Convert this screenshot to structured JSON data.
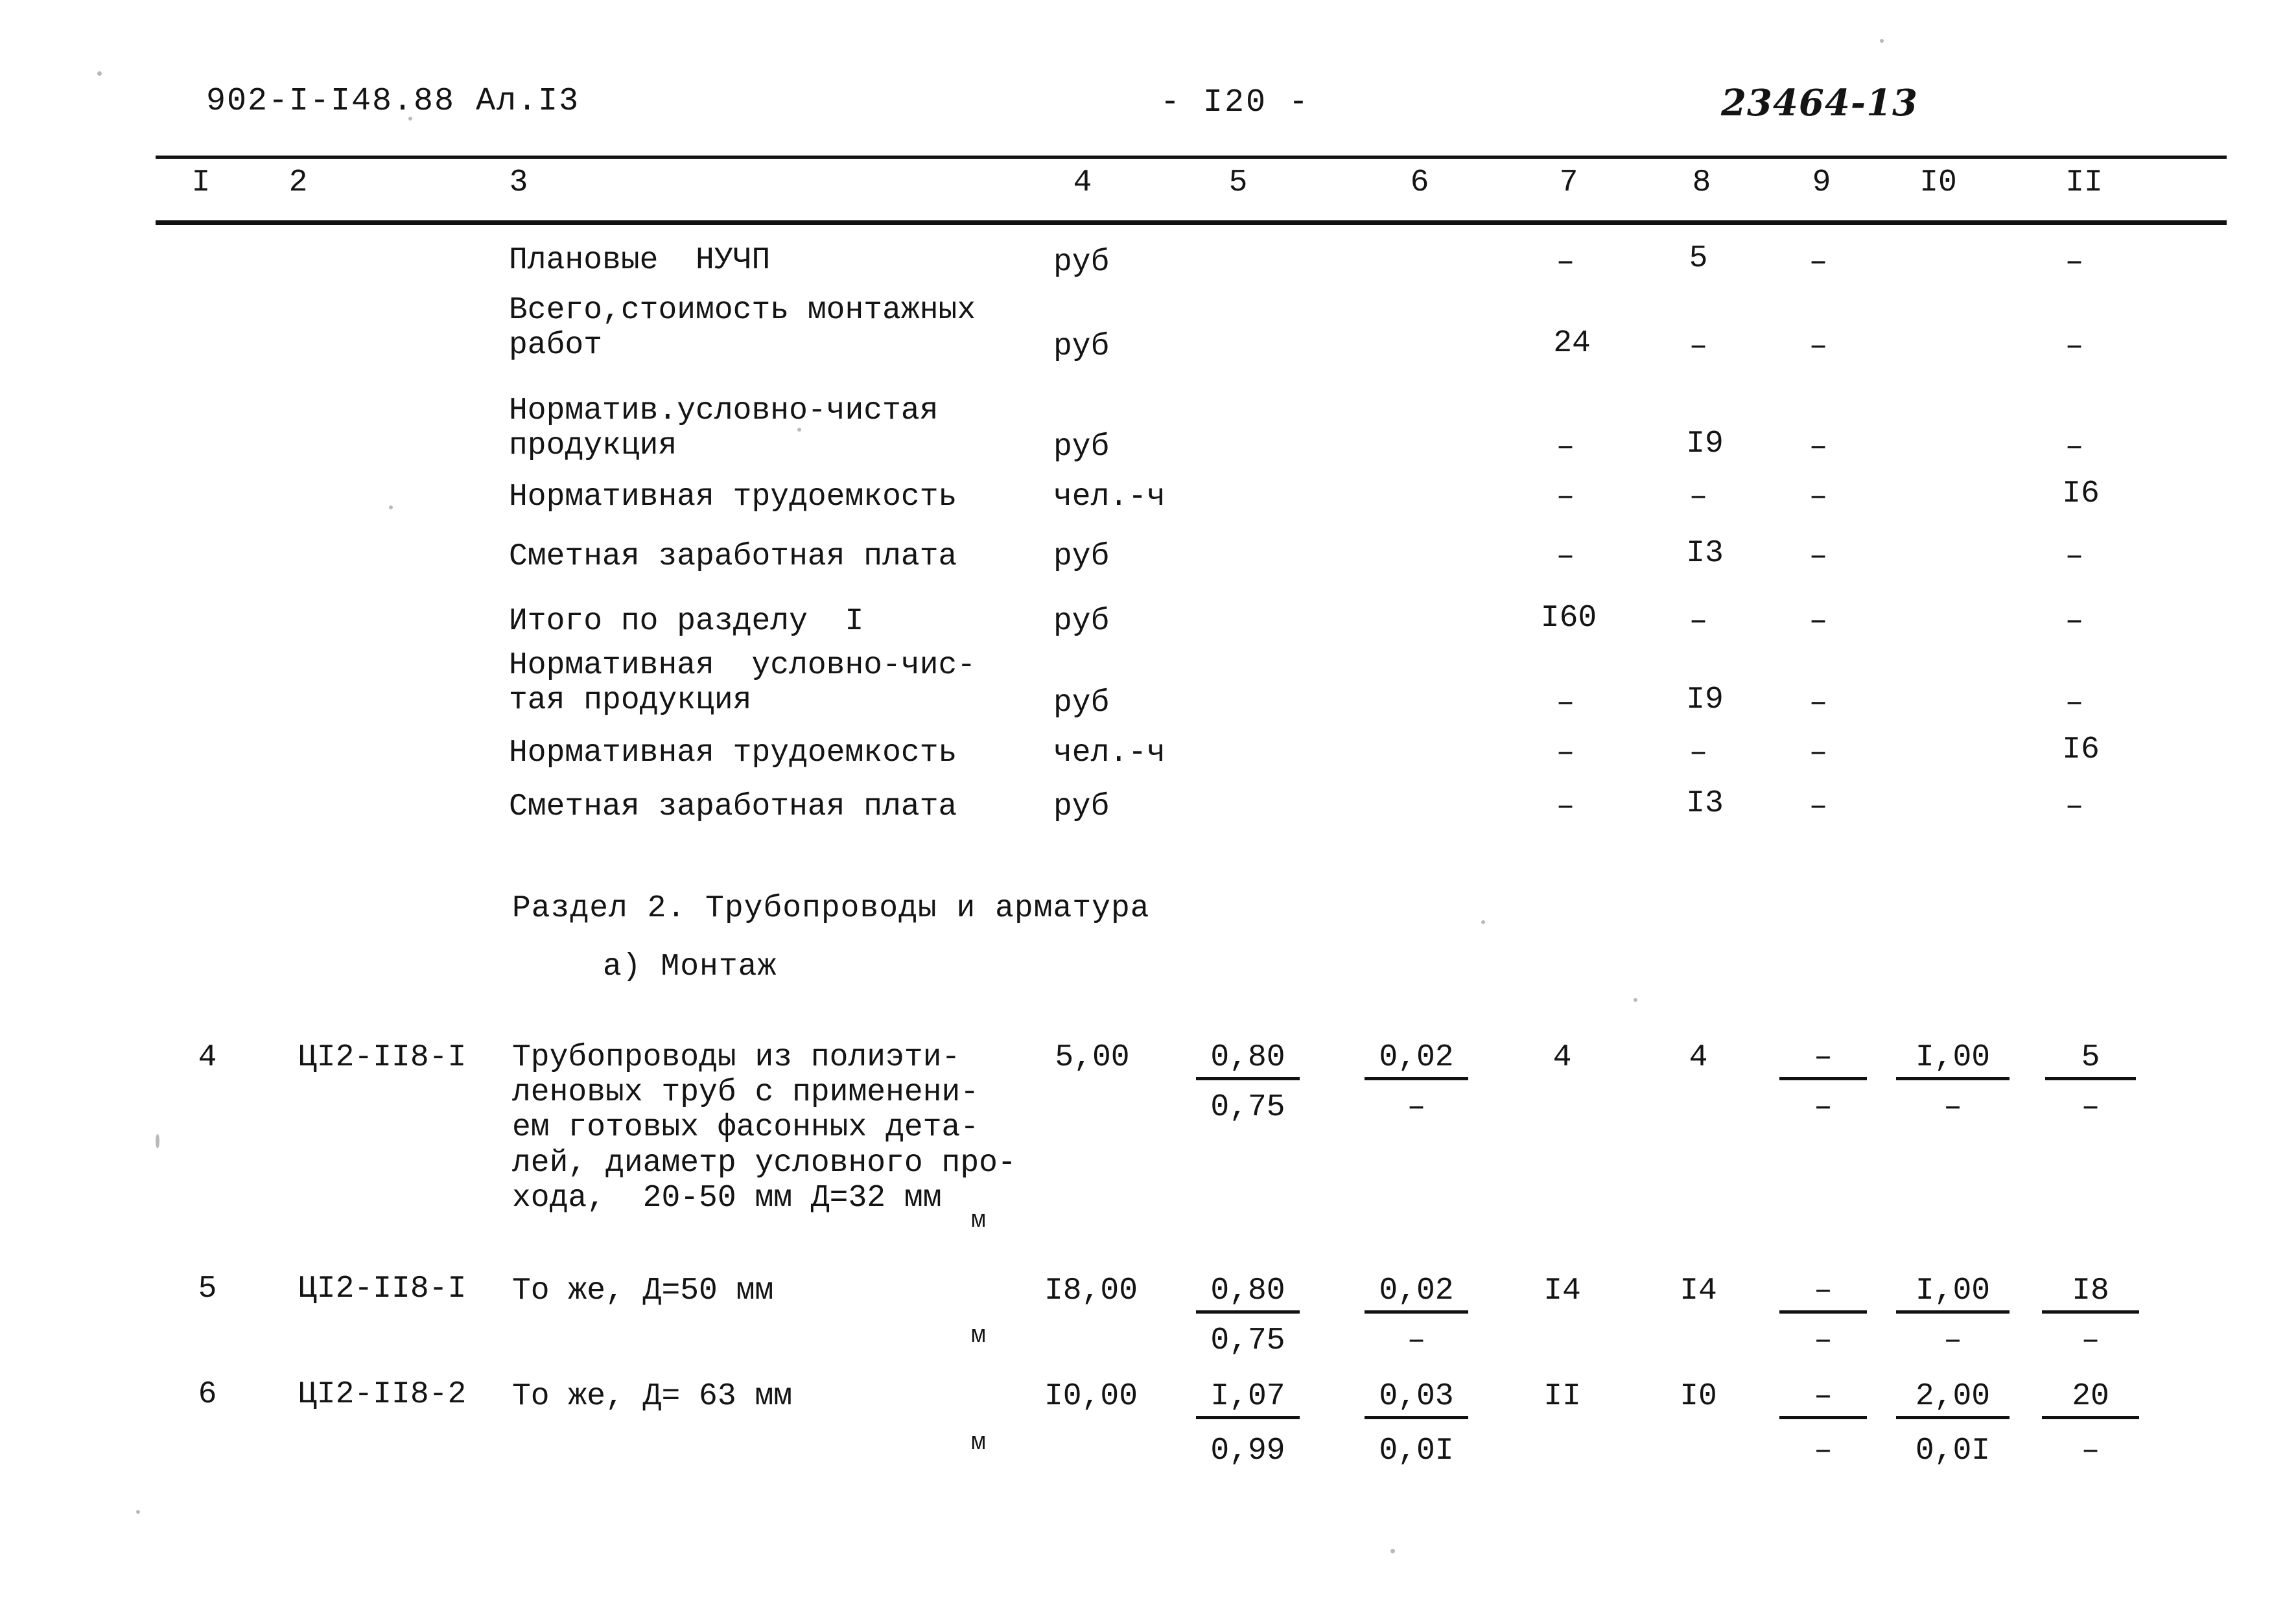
{
  "header": {
    "left_code": "902-I-I48.88  Ал.I3",
    "page_number": "-  I20  -",
    "doc_number": "23464-13"
  },
  "table": {
    "column_headers": [
      "I",
      "2",
      "3",
      "4",
      "5",
      "6",
      "7",
      "8",
      "9",
      "I0",
      "II"
    ],
    "rows": [
      {
        "no": "",
        "code": "",
        "description": "Плановые  НУЧП",
        "unit": "руб",
        "c5_top": "",
        "c5_bot": "",
        "c6_top": "",
        "c6_bot": "",
        "c7": "–",
        "c8": "5",
        "c9_top": "–",
        "c9_bot": "",
        "c10_top": "",
        "c10_bot": "",
        "c11_top": "–",
        "c11_bot": ""
      },
      {
        "no": "",
        "code": "",
        "description": "Всего,стоимость монтажных\nработ",
        "unit": "руб",
        "c7": "24",
        "c8": "–",
        "c9_top": "–",
        "c11_top": "–"
      },
      {
        "no": "",
        "code": "",
        "description": "Норматив.условно-чистая\nпродукция",
        "unit": "руб",
        "c7": "–",
        "c8": "I9",
        "c9_top": "–",
        "c11_top": "–"
      },
      {
        "no": "",
        "code": "",
        "description": "Нормативная трудоемкость",
        "unit": "чел.-ч",
        "c7": "–",
        "c8": "–",
        "c9_top": "–",
        "c11_top": "I6"
      },
      {
        "no": "",
        "code": "",
        "description": "Сметная заработная плата",
        "unit": "руб",
        "c7": "–",
        "c8": "I3",
        "c9_top": "–",
        "c11_top": "–"
      },
      {
        "no": "",
        "code": "",
        "description": "Итого по разделу  I",
        "unit": "руб",
        "c7": "I60",
        "c8": "–",
        "c9_top": "–",
        "c11_top": "–"
      },
      {
        "no": "",
        "code": "",
        "description": "Нормативная  условно-чис-\nтая продукция",
        "unit": "руб",
        "c7": "–",
        "c8": "I9",
        "c9_top": "–",
        "c11_top": "–"
      },
      {
        "no": "",
        "code": "",
        "description": "Нормативная трудоемкость",
        "unit": "чел.-ч",
        "c7": "–",
        "c8": "–",
        "c9_top": "–",
        "c11_top": "I6"
      },
      {
        "no": "",
        "code": "",
        "description": "Сметная заработная плата",
        "unit": "руб",
        "c7": "–",
        "c8": "I3",
        "c9_top": "–",
        "c11_top": "–"
      }
    ],
    "section_title": "Раздел 2. Трубопроводы и арматура",
    "subsection_title": "а)   Монтаж",
    "item_rows": [
      {
        "no": "4",
        "code": "ЦI2-II8-I",
        "description": "Трубопроводы из полиэти-\nленовых труб с применени-\nем готовых фасонных дета-\nлей, диаметр условного про-\nхода,  20-50 мм Д=32 мм",
        "unit": "м",
        "c4": "5,00",
        "c5_top": "0,80",
        "c5_bot": "0,75",
        "c6_top": "0,02",
        "c6_bot": "–",
        "c7": "4",
        "c8": "4",
        "c9_top": "–",
        "c9_bot": "–",
        "c10_top": "I,00",
        "c10_bot": "–",
        "c11_top": "5",
        "c11_bot": "–"
      },
      {
        "no": "5",
        "code": "ЦI2-II8-I",
        "description": "То же, Д=50 мм",
        "unit": "м",
        "c4": "I8,00",
        "c5_top": "0,80",
        "c5_bot": "0,75",
        "c6_top": "0,02",
        "c6_bot": "–",
        "c7": "I4",
        "c8": "I4",
        "c9_top": "–",
        "c9_bot": "–",
        "c10_top": "I,00",
        "c10_bot": "–",
        "c11_top": "I8",
        "c11_bot": "–"
      },
      {
        "no": "6",
        "code": "ЦI2-II8-2",
        "description": "То же, Д= 63 мм",
        "unit": "м",
        "c4": "I0,00",
        "c5_top": "I,07",
        "c5_bot": "0,99",
        "c6_top": "0,03",
        "c6_bot": "0,0I",
        "c7": "II",
        "c8": "I0",
        "c9_top": "–",
        "c9_bot": "–",
        "c10_top": "2,00",
        "c10_bot": "0,0I",
        "c11_top": "20",
        "c11_bot": "–"
      }
    ]
  }
}
